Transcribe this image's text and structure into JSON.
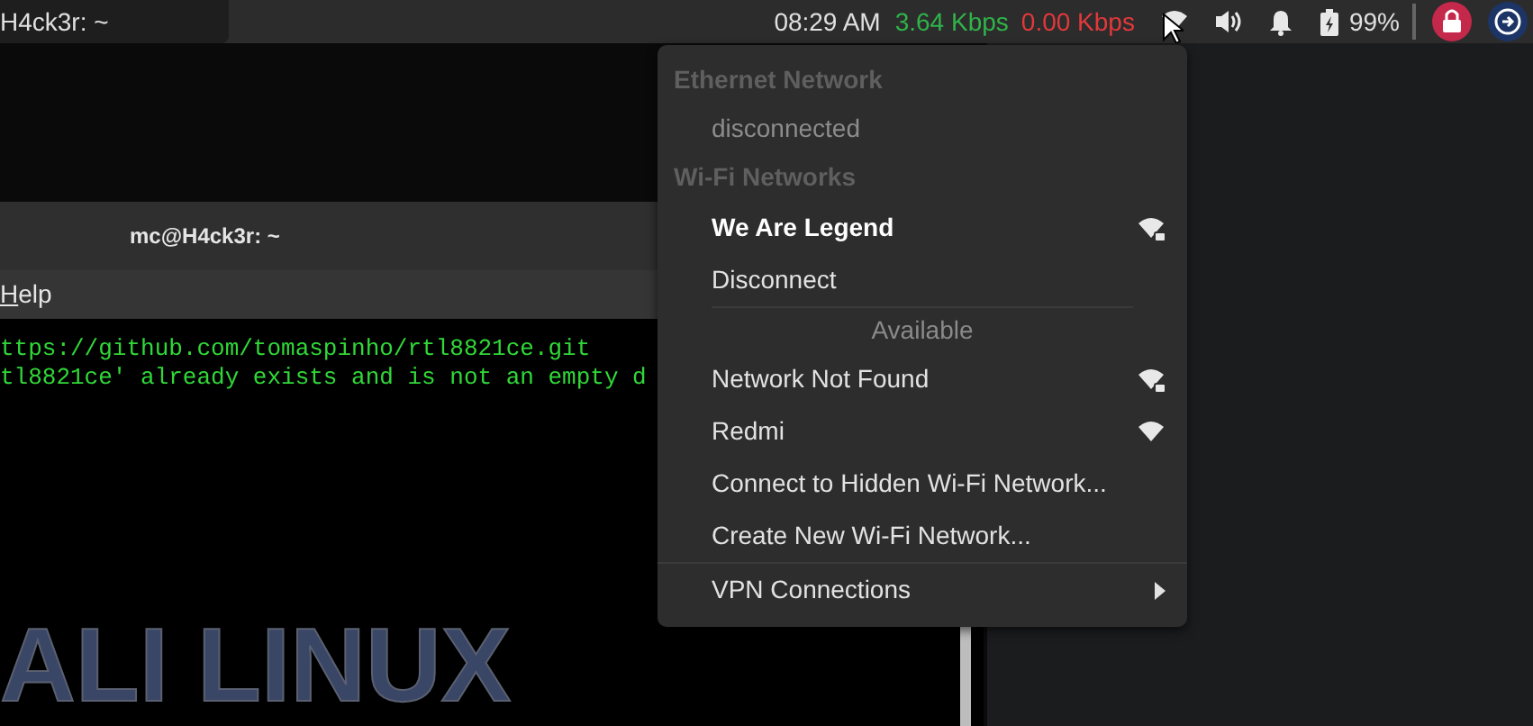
{
  "top_panel": {
    "window_tab": {
      "title": "H4ck3r: ~"
    },
    "clock": "08:29 AM",
    "download_speed": "3.64 Kbps",
    "upload_speed": "0.00 Kbps",
    "battery": "99%"
  },
  "terminal": {
    "title": "mc@H4ck3r: ~",
    "menu": [
      "Help"
    ],
    "lines": [
      "ttps://github.com/tomaspinho/rtl8821ce.git",
      "tl8821ce' already exists and is not an empty d"
    ],
    "wallpaper_text": "ALI LINUX"
  },
  "network_menu": {
    "items": [
      {
        "kind": "header",
        "label": "Ethernet Network"
      },
      {
        "kind": "status",
        "label": "disconnected"
      },
      {
        "kind": "header",
        "label": "Wi-Fi Networks"
      },
      {
        "kind": "network",
        "label": "We Are Legend",
        "selected": true,
        "secured": true
      },
      {
        "kind": "action",
        "label": "Disconnect"
      },
      {
        "kind": "section",
        "label": "Available"
      },
      {
        "kind": "network",
        "label": "Network Not Found",
        "selected": false,
        "secured": true
      },
      {
        "kind": "network",
        "label": "Redmi",
        "selected": false,
        "secured": false
      },
      {
        "kind": "action",
        "label": "Connect to Hidden Wi-Fi Network..."
      },
      {
        "kind": "action",
        "label": "Create New Wi-Fi Network..."
      },
      {
        "kind": "separator"
      },
      {
        "kind": "submenu",
        "label": "VPN Connections"
      }
    ]
  }
}
